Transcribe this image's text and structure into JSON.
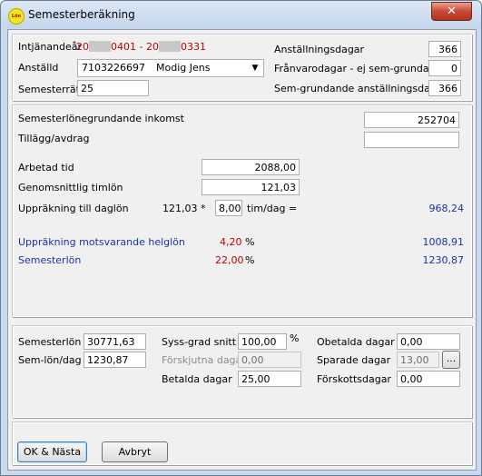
{
  "window": {
    "title": "Semesterberäkning",
    "icon_text": "Lön",
    "close": "✕"
  },
  "top": {
    "intjanandear_label": "Intjänandeår",
    "intjanandear_part1": "20",
    "intjanandear_part2": "0401 - 20",
    "intjanandear_part3": "0331",
    "anstalld_label": "Anställd",
    "anstalld_id": "7103226697",
    "anstalld_name": "Modig Jens",
    "semesterratt_label": "Semesterrätt",
    "semesterratt_value": "25",
    "anstallningsdagar_label": "Anställningsdagar",
    "anstallningsdagar_value": "366",
    "franvarodagar_label": "Frånvarodagar - ej sem-grundande",
    "franvarodagar_value": "0",
    "semgrundande_label": "Sem-grundande anställningsdagar",
    "semgrundande_value": "366"
  },
  "middle": {
    "inkomst_label": "Semesterlönegrundande inkomst",
    "inkomst_value": "252704",
    "tillagg_label": "Tillägg/avdrag",
    "tillagg_value": "",
    "arbetad_label": "Arbetad tid",
    "arbetad_value": "2088,00",
    "timlon_label": "Genomsnittlig timlön",
    "timlon_value": "121,03",
    "daglon_label": "Uppräkning till daglön",
    "daglon_factor": "121,03 *",
    "daglon_hours": "8,00",
    "daglon_unit": "tim/dag  =",
    "daglon_result": "968,24",
    "helglon_label": "Uppräkning motsvarande helglön",
    "helglon_pct": "4,20",
    "helglon_pct_sign": "%",
    "helglon_result": "1008,91",
    "semesterlon_label": "Semesterlön",
    "semesterlon_pct": "22,00",
    "semesterlon_pct_sign": "%",
    "semesterlon_result": "1230,87"
  },
  "bottom": {
    "semesterlon_label": "Semesterlön",
    "semesterlon_value": "30771,63",
    "semlon_dag_label": "Sem-lön/dag",
    "semlon_dag_value": "1230,87",
    "syssgrad_label": "Syss-grad snitt",
    "syssgrad_value": "100,00",
    "syssgrad_sign": "%",
    "forskjutna_label": "Förskjutna dagar",
    "forskjutna_value": "0,00",
    "betalda_label": "Betalda dagar",
    "betalda_value": "25,00",
    "obetalda_label": "Obetalda dagar",
    "obetalda_value": "0,00",
    "sparade_label": "Sparade dagar",
    "sparade_value": "13,00",
    "sparade_button": "...",
    "forskott_label": "Förskottsdagar",
    "forskott_value": "0,00"
  },
  "buttons": {
    "ok": "OK & Nästa",
    "cancel": "Avbryt"
  }
}
